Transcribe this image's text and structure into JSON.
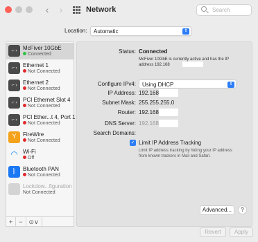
{
  "window": {
    "title": "Network",
    "search_placeholder": "Search"
  },
  "location": {
    "label": "Location:",
    "value": "Automatic"
  },
  "services": [
    {
      "name": "McFiver 10GbE",
      "status": "Connected",
      "status_color": "#31c048",
      "icon": "ethernet-icon",
      "selected": true
    },
    {
      "name": "Ethernet 1",
      "status": "Not Connected",
      "status_color": "#e0292b",
      "icon": "ethernet-icon"
    },
    {
      "name": "Ethernet 2",
      "status": "Not Connected",
      "status_color": "#e0292b",
      "icon": "ethernet-icon"
    },
    {
      "name": "PCI Ethernet Slot 4",
      "status": "Not Connected",
      "status_color": "#e0292b",
      "icon": "ethernet-icon"
    },
    {
      "name": "PCI Ether...t 4, Port 1",
      "status": "Not Connected",
      "status_color": "#e0292b",
      "icon": "ethernet-icon"
    },
    {
      "name": "FireWire",
      "status": "Not Connected",
      "status_color": "#e0292b",
      "icon": "firewire-icon"
    },
    {
      "name": "Wi-Fi",
      "status": "Off",
      "status_color": "#e0292b",
      "icon": "wifi-icon"
    },
    {
      "name": "Bluetooth PAN",
      "status": "Not Connected",
      "status_color": "#e0292b",
      "icon": "bluetooth-icon"
    },
    {
      "name": "Lockdow...figuration",
      "status": "Not Connected",
      "status_color": "",
      "icon": "lock-icon"
    }
  ],
  "sidebar_toolbar": {
    "add": "+",
    "remove": "−",
    "action": "⊙∨"
  },
  "detail": {
    "status_label": "Status:",
    "status_value": "Connected",
    "status_desc": "McFiver 10GbE is currently active and has the IP address 192.168",
    "configure_label": "Configure IPv4:",
    "configure_value": "Using DHCP",
    "ip_label": "IP Address:",
    "ip_value": "192.168.",
    "mask_label": "Subnet Mask:",
    "mask_value": "255.255.255.0",
    "router_label": "Router:",
    "router_value": "192.168",
    "dns_label": "DNS Server:",
    "dns_value": "192.168",
    "search_domains_label": "Search Domains:",
    "limit_label": "Limit IP Address Tracking",
    "limit_desc": "Limit IP address tracking by hiding your IP address from known trackers in Mail and Safari."
  },
  "buttons": {
    "advanced": "Advanced...",
    "help": "?",
    "revert": "Revert",
    "apply": "Apply"
  },
  "colors": {
    "accent": "#2c7df6",
    "connected": "#31c048",
    "not_connected": "#e0292b"
  }
}
